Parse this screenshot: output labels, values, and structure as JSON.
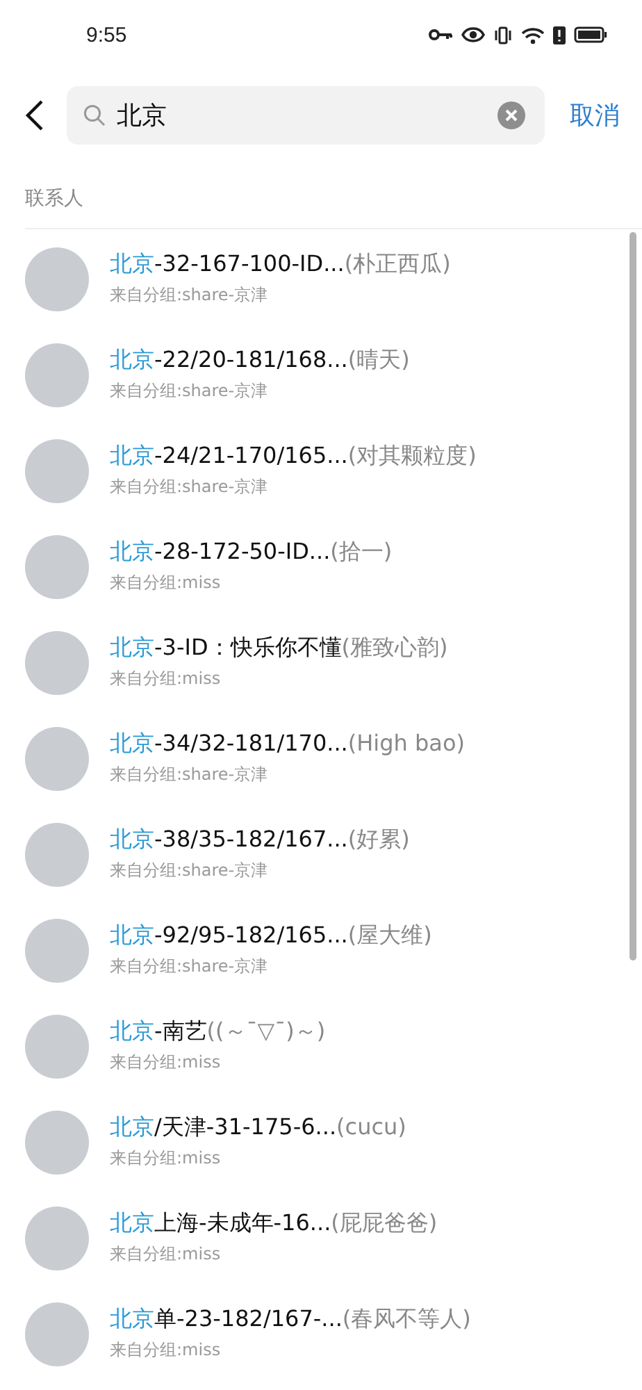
{
  "status_bar": {
    "time": "9:55"
  },
  "search": {
    "value": "北京",
    "cancel": "取消"
  },
  "section": {
    "title": "联系人"
  },
  "contacts": [
    {
      "match": "北京",
      "rest": "-32-167-100-ID...",
      "nickname": "(朴正西瓜)",
      "group": "来自分组:share-京津"
    },
    {
      "match": "北京",
      "rest": "-22/20-181/168...",
      "nickname": "(晴天)",
      "group": "来自分组:share-京津"
    },
    {
      "match": "北京",
      "rest": "-24/21-170/165...",
      "nickname": "(对其颗粒度)",
      "group": "来自分组:share-京津"
    },
    {
      "match": "北京",
      "rest": "-28-172-50-ID...",
      "nickname": "(拾一)",
      "group": "来自分组:miss"
    },
    {
      "match": "北京",
      "rest": "-3-ID：快乐你不懂",
      "nickname": "(雅致心韵)",
      "group": "来自分组:miss"
    },
    {
      "match": "北京",
      "rest": "-34/32-181/170...",
      "nickname": "(High bao)",
      "group": "来自分组:share-京津"
    },
    {
      "match": "北京",
      "rest": "-38/35-182/167...",
      "nickname": "(好累)",
      "group": "来自分组:share-京津"
    },
    {
      "match": "北京",
      "rest": "-92/95-182/165...",
      "nickname": "(屋大维)",
      "group": "来自分组:share-京津"
    },
    {
      "match": "北京",
      "rest": "-南艺",
      "nickname": "((～ˉ▽ˉ)～)",
      "group": "来自分组:miss"
    },
    {
      "match": "北京",
      "rest": "/天津-31-175-6...",
      "nickname": "(cucu)",
      "group": "来自分组:miss"
    },
    {
      "match": "北京",
      "rest": "上海-未成年-16...",
      "nickname": "(屁屁爸爸)",
      "group": "来自分组:miss"
    },
    {
      "match": "北京",
      "rest": "单-23-182/167-...",
      "nickname": "(春风不等人)",
      "group": "来自分组:miss"
    }
  ]
}
